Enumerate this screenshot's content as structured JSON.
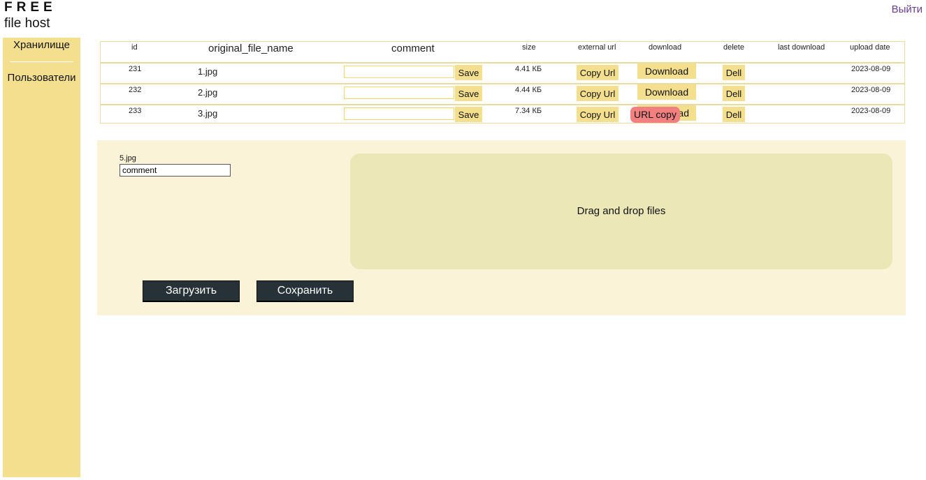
{
  "logo": {
    "line1": "FREE",
    "line2": "file host"
  },
  "header": {
    "logout": "Выйти"
  },
  "sidebar": {
    "items": [
      {
        "label": "Хранилище"
      },
      {
        "label": "Пользователи"
      }
    ]
  },
  "table": {
    "columns": {
      "id": "id",
      "name": "original_file_name",
      "comment": "comment",
      "size": "size",
      "external_url": "external url",
      "download": "download",
      "delete": "delete",
      "last_download": "last download",
      "upload_date": "upload date"
    },
    "rows": [
      {
        "id": "231",
        "name": "1.jpg",
        "comment": "",
        "size": "4.41 КБ",
        "last_download": "",
        "upload_date": "2023-08-09"
      },
      {
        "id": "232",
        "name": "2.jpg",
        "comment": "",
        "size": "4.44 КБ",
        "last_download": "",
        "upload_date": "2023-08-09"
      },
      {
        "id": "233",
        "name": "3.jpg",
        "comment": "",
        "size": "7.34 КБ",
        "last_download": "",
        "upload_date": "2023-08-09"
      }
    ],
    "buttons": {
      "save": "Save",
      "copy_url": "Copy Url",
      "download": "Download",
      "download_partial": "ad",
      "delete": "Dell"
    },
    "toast": "URL copy"
  },
  "upload": {
    "file_name": "5.jpg",
    "comment_value": "comment",
    "dropzone_text": "Drag and drop files",
    "upload_button": "Загрузить",
    "save_button": "Сохранить"
  },
  "colors": {
    "accent_yellow": "#f4df8e",
    "panel_bg": "#faf3d8",
    "dropzone_bg": "#ece7b7",
    "dark_button": "#263238",
    "toast": "#f28080",
    "logout_link": "#6a3d8f"
  }
}
